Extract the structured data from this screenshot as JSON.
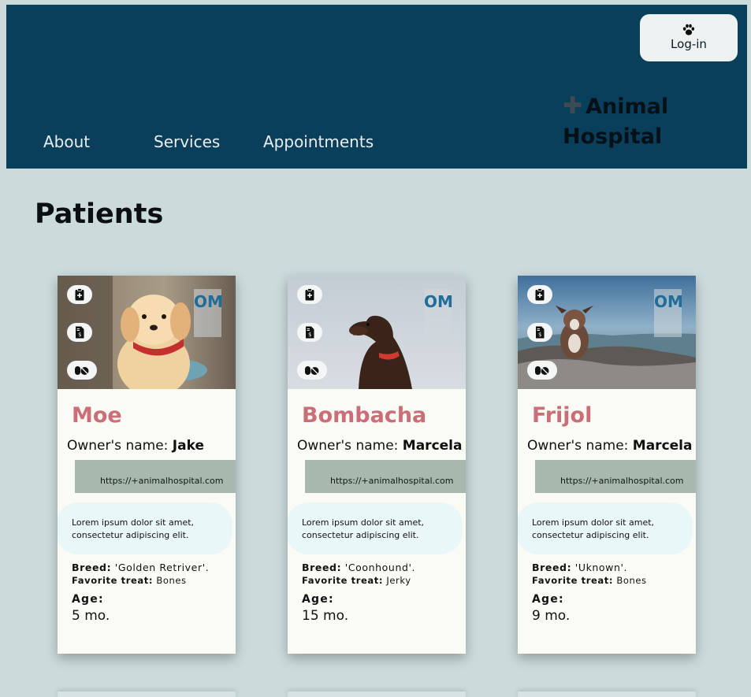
{
  "header": {
    "login_label": "Log-in",
    "nav": [
      "About",
      "Services",
      "Appointments"
    ],
    "brand_line1": "Animal",
    "brand_line2": "Hospital",
    "colors": {
      "header_bg": "#0a3f5c",
      "page_bg": "#cbdadb",
      "pet_name": "#cc6e78"
    }
  },
  "page_title": "Patients",
  "icons": [
    "paw-icon",
    "plus-icon",
    "clipboard-plus-icon",
    "invoice-dollar-icon",
    "pills-icon"
  ],
  "cards": [
    {
      "badge": "OM",
      "name": "Moe",
      "owner_label": "Owner's name:",
      "owner": "Jake",
      "url": "https://+animalhospital.com",
      "description": "Lorem ipsum dolor sit amet, consectetur adipiscing elit.",
      "breed_label": "Breed:",
      "breed": "'Golden Retriver'.",
      "treat_label": "Favorite treat:",
      "treat": "Bones",
      "age_label": "Age:",
      "age": "5 mo."
    },
    {
      "badge": "OM",
      "name": "Bombacha",
      "owner_label": "Owner's name:",
      "owner": "Marcela",
      "url": "https://+animalhospital.com",
      "description": "Lorem ipsum dolor sit amet, consectetur adipiscing elit.",
      "breed_label": "Breed:",
      "breed": "'Coonhound'.",
      "treat_label": "Favorite treat:",
      "treat": "Jerky",
      "age_label": "Age:",
      "age": "15 mo."
    },
    {
      "badge": "OM",
      "name": "Frijol",
      "owner_label": "Owner's name:",
      "owner": "Marcela",
      "url": "https://+animalhospital.com",
      "description": "Lorem ipsum dolor sit amet, consectetur adipiscing elit.",
      "breed_label": "Breed:",
      "breed": "'Uknown'.",
      "treat_label": "Favorite treat:",
      "treat": "Bones",
      "age_label": "Age:",
      "age": "9 mo."
    }
  ]
}
